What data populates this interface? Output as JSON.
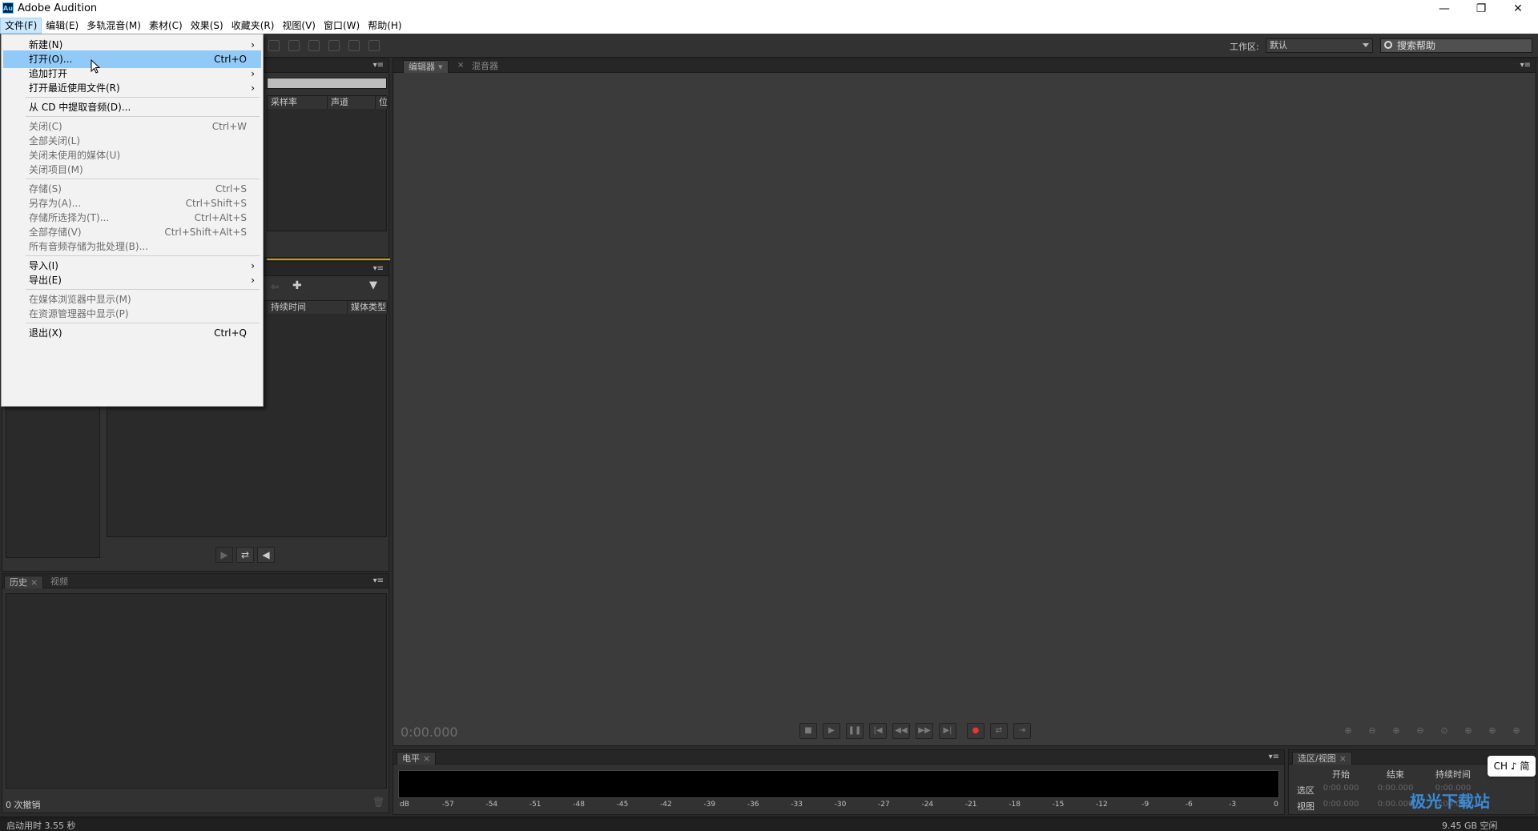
{
  "window": {
    "title": "Adobe Audition",
    "app_icon": "Au",
    "minimize": "—",
    "maximize": "❐",
    "close": "✕"
  },
  "menubar": [
    "文件(F)",
    "编辑(E)",
    "多轨混音(M)",
    "素材(C)",
    "效果(S)",
    "收藏夹(R)",
    "视图(V)",
    "窗口(W)",
    "帮助(H)"
  ],
  "toolbar": {
    "workspace_label": "工作区:",
    "workspace_value": "默认",
    "search_placeholder": "搜索帮助"
  },
  "files_panel": {
    "columns": [
      "采样率",
      "声道",
      "位"
    ]
  },
  "media_panel": {
    "columns": [
      "持续时间",
      "媒体类型"
    ]
  },
  "editor_panel": {
    "tabs": [
      "编辑器",
      "混音器"
    ],
    "timecode": "0:00.000"
  },
  "history_panel": {
    "tabs": [
      "历史",
      "视频"
    ],
    "undo_count": "0 次撤销"
  },
  "levels_panel": {
    "tab": "电平",
    "scale": [
      "dB",
      "-57",
      "-54",
      "-51",
      "-48",
      "-45",
      "-42",
      "-39",
      "-36",
      "-33",
      "-30",
      "-27",
      "-24",
      "-21",
      "-18",
      "-15",
      "-12",
      "-9",
      "-6",
      "-3",
      "0"
    ]
  },
  "selection_panel": {
    "tab": "选区/视图",
    "headers": [
      "开始",
      "结束",
      "持续时间"
    ],
    "rows": [
      {
        "label": "选区",
        "values": [
          "0:00.000",
          "0:00.000",
          "0:00.000"
        ]
      },
      {
        "label": "视图",
        "values": [
          "0:00.000",
          "0:00.000",
          "0:00.000"
        ]
      }
    ]
  },
  "status": {
    "startup": "启动用时 3.55 秒",
    "disk": "9.45 GB 空闲"
  },
  "ime": "CH ♪ 简",
  "watermark": "极光下载站",
  "file_menu": {
    "items": [
      {
        "label": "新建(N)",
        "shortcut": "",
        "submenu": true,
        "disabled": false,
        "highlight": false
      },
      {
        "label": "打开(O)...",
        "shortcut": "Ctrl+O",
        "submenu": false,
        "disabled": false,
        "highlight": true
      },
      {
        "label": "追加打开",
        "shortcut": "",
        "submenu": true,
        "disabled": false,
        "highlight": false
      },
      {
        "label": "打开最近使用文件(R)",
        "shortcut": "",
        "submenu": true,
        "disabled": false,
        "highlight": false
      },
      {
        "label": "从 CD 中提取音频(D)...",
        "shortcut": "",
        "submenu": false,
        "disabled": false,
        "highlight": false
      },
      {
        "label": "关闭(C)",
        "shortcut": "Ctrl+W",
        "submenu": false,
        "disabled": true,
        "highlight": false
      },
      {
        "label": "全部关闭(L)",
        "shortcut": "",
        "submenu": false,
        "disabled": true,
        "highlight": false
      },
      {
        "label": "关闭未使用的媒体(U)",
        "shortcut": "",
        "submenu": false,
        "disabled": true,
        "highlight": false
      },
      {
        "label": "关闭项目(M)",
        "shortcut": "",
        "submenu": false,
        "disabled": true,
        "highlight": false
      },
      {
        "label": "存储(S)",
        "shortcut": "Ctrl+S",
        "submenu": false,
        "disabled": true,
        "highlight": false
      },
      {
        "label": "另存为(A)...",
        "shortcut": "Ctrl+Shift+S",
        "submenu": false,
        "disabled": true,
        "highlight": false
      },
      {
        "label": "存储所选择为(T)...",
        "shortcut": "Ctrl+Alt+S",
        "submenu": false,
        "disabled": true,
        "highlight": false
      },
      {
        "label": "全部存储(V)",
        "shortcut": "Ctrl+Shift+Alt+S",
        "submenu": false,
        "disabled": true,
        "highlight": false
      },
      {
        "label": "所有音频存储为批处理(B)...",
        "shortcut": "",
        "submenu": false,
        "disabled": true,
        "highlight": false
      },
      {
        "label": "导入(I)",
        "shortcut": "",
        "submenu": true,
        "disabled": false,
        "highlight": false
      },
      {
        "label": "导出(E)",
        "shortcut": "",
        "submenu": true,
        "disabled": false,
        "highlight": false
      },
      {
        "label": "在媒体浏览器中显示(M)",
        "shortcut": "",
        "submenu": false,
        "disabled": true,
        "highlight": false
      },
      {
        "label": "在资源管理器中显示(P)",
        "shortcut": "",
        "submenu": false,
        "disabled": true,
        "highlight": false
      },
      {
        "label": "退出(X)",
        "shortcut": "Ctrl+Q",
        "submenu": false,
        "disabled": false,
        "highlight": false
      }
    ]
  }
}
